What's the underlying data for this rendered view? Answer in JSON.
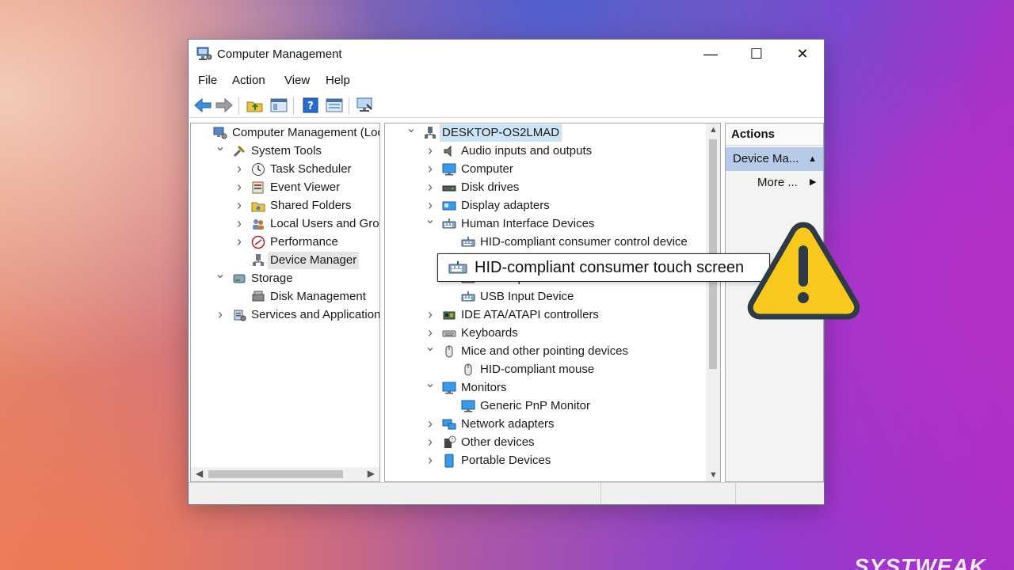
{
  "window": {
    "title": "Computer Management",
    "minimize": "—",
    "maximize": "☐",
    "close": "✕"
  },
  "menu": [
    "File",
    "Action",
    "View",
    "Help"
  ],
  "left_tree": [
    {
      "label": "Computer Management (Local",
      "depth": 0,
      "chevron": "",
      "icon": "computer-management-icon"
    },
    {
      "label": "System Tools",
      "depth": 1,
      "chevron": "v",
      "icon": "system-tools-icon"
    },
    {
      "label": "Task Scheduler",
      "depth": 2,
      "chevron": ">",
      "icon": "clock-icon"
    },
    {
      "label": "Event Viewer",
      "depth": 2,
      "chevron": ">",
      "icon": "event-viewer-icon"
    },
    {
      "label": "Shared Folders",
      "depth": 2,
      "chevron": ">",
      "icon": "shared-folder-icon"
    },
    {
      "label": "Local Users and Groups",
      "depth": 2,
      "chevron": ">",
      "icon": "users-icon"
    },
    {
      "label": "Performance",
      "depth": 2,
      "chevron": ">",
      "icon": "performance-icon"
    },
    {
      "label": "Device Manager",
      "depth": 2,
      "chevron": "",
      "icon": "device-manager-icon",
      "selected": true
    },
    {
      "label": "Storage",
      "depth": 1,
      "chevron": "v",
      "icon": "storage-icon"
    },
    {
      "label": "Disk Management",
      "depth": 2,
      "chevron": "",
      "icon": "disk-management-icon"
    },
    {
      "label": "Services and Applications",
      "depth": 1,
      "chevron": ">",
      "icon": "services-icon"
    }
  ],
  "device_tree": [
    {
      "label": "DESKTOP-OS2LMAD",
      "depth": 0,
      "chevron": "v",
      "icon": "desktop-icon",
      "selected": true
    },
    {
      "label": "Audio inputs and outputs",
      "depth": 1,
      "chevron": ">",
      "icon": "speaker-icon"
    },
    {
      "label": "Computer",
      "depth": 1,
      "chevron": ">",
      "icon": "monitor-icon"
    },
    {
      "label": "Disk drives",
      "depth": 1,
      "chevron": ">",
      "icon": "disk-drive-icon"
    },
    {
      "label": "Display adapters",
      "depth": 1,
      "chevron": ">",
      "icon": "display-adapter-icon"
    },
    {
      "label": "Human Interface Devices",
      "depth": 1,
      "chevron": "v",
      "icon": "hid-icon"
    },
    {
      "label": "HID-compliant consumer control device",
      "depth": 2,
      "chevron": "",
      "icon": "hid-icon"
    },
    {
      "label": "",
      "depth": 2,
      "chevron": "",
      "icon": "hid-icon"
    },
    {
      "label": "USB Input Device",
      "depth": 2,
      "chevron": "",
      "icon": "hid-icon"
    },
    {
      "label": "USB Input Device",
      "depth": 2,
      "chevron": "",
      "icon": "hid-icon"
    },
    {
      "label": "IDE ATA/ATAPI controllers",
      "depth": 1,
      "chevron": ">",
      "icon": "ide-controller-icon"
    },
    {
      "label": "Keyboards",
      "depth": 1,
      "chevron": ">",
      "icon": "keyboard-icon"
    },
    {
      "label": "Mice and other pointing devices",
      "depth": 1,
      "chevron": "v",
      "icon": "mouse-icon"
    },
    {
      "label": "HID-compliant mouse",
      "depth": 2,
      "chevron": "",
      "icon": "mouse-icon"
    },
    {
      "label": "Monitors",
      "depth": 1,
      "chevron": "v",
      "icon": "monitor-icon"
    },
    {
      "label": "Generic PnP Monitor",
      "depth": 2,
      "chevron": "",
      "icon": "monitor-icon"
    },
    {
      "label": "Network adapters",
      "depth": 1,
      "chevron": ">",
      "icon": "network-adapter-icon"
    },
    {
      "label": "Other devices",
      "depth": 1,
      "chevron": ">",
      "icon": "other-devices-icon"
    },
    {
      "label": "Portable Devices",
      "depth": 1,
      "chevron": ">",
      "icon": "portable-devices-icon"
    }
  ],
  "actions": {
    "header": "Actions",
    "section": "Device Ma...",
    "more": "More ..."
  },
  "callout": {
    "label": "HID-compliant consumer touch screen"
  },
  "brand": "SYSTWEAK",
  "colors": {
    "warning_fill": "#f8c81e",
    "warning_stroke": "#2e3a44",
    "selection": "#cce4f7",
    "actions_section": "#b7cbe8"
  }
}
